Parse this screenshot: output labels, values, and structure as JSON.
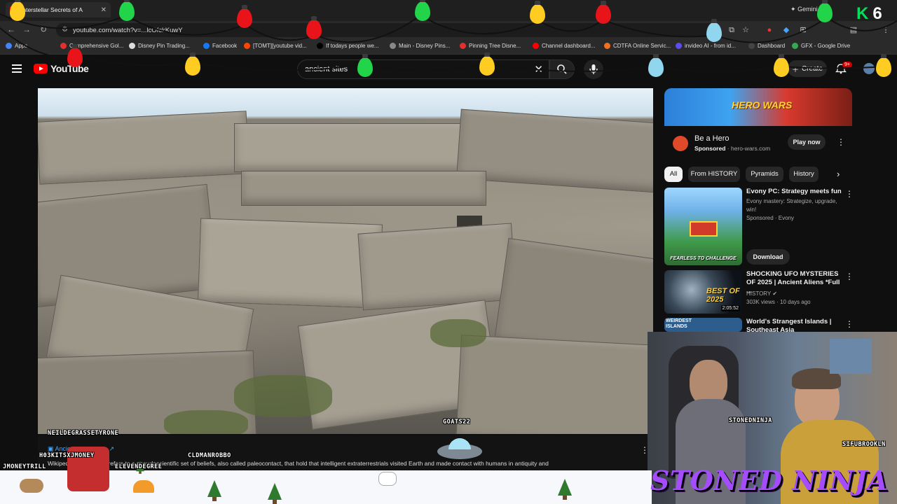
{
  "browser": {
    "tab_title": "Interstellar Secrets of A",
    "url": "youtube.com/watch?v=...lcOfckKuwY",
    "bookmarks": [
      {
        "label": "Apps",
        "color": "#4285f4"
      },
      {
        "label": "Comprehensive Gol...",
        "color": "#e03030"
      },
      {
        "label": "Disney Pin Trading...",
        "color": "#dddddd"
      },
      {
        "label": "Facebook",
        "color": "#1877f2"
      },
      {
        "label": "[TOMT][youtube vid...",
        "color": "#ff4500"
      },
      {
        "label": "If todays people we...",
        "color": "#000000"
      },
      {
        "label": "Main - Disney Pins...",
        "color": "#888888"
      },
      {
        "label": "Pinning Tree Disne...",
        "color": "#e03030"
      },
      {
        "label": "Channel dashboard...",
        "color": "#ff0000"
      },
      {
        "label": "CDTFA Online Servic...",
        "color": "#f07020"
      },
      {
        "label": "invideo AI - from id...",
        "color": "#5b4df0"
      },
      {
        "label": "Dashboard",
        "color": "#444444"
      },
      {
        "label": "GFX - Google Drive",
        "color": "#34a853"
      }
    ],
    "gemini_label": "Gemini"
  },
  "youtube": {
    "logo_text": "YouTube",
    "search_query": "ancient sites",
    "create_label": "Create",
    "notif_badge": "9+"
  },
  "ad": {
    "banner_text": "HERO WARS",
    "title": "Be a Hero",
    "sponsored": "Sponsored",
    "domain": "hero-wars.com",
    "cta": "Play now"
  },
  "chips": [
    "All",
    "From HISTORY",
    "Pyramids",
    "History"
  ],
  "recs": [
    {
      "title": "Evony PC: Strategy meets fun",
      "line1": "Evony mastery: Strategize, upgrade,",
      "line2": "win!",
      "line3": "Sponsored · Evony",
      "thumb_text": "FEARLESS TO CHALLENGE",
      "cta": "Download"
    },
    {
      "title": "SHOCKING UFO MYSTERIES OF 2025 | Ancient Aliens *Full ...",
      "line1": "HISTORY",
      "line2": "303K views · 10 days ago",
      "thumb_text": "BEST OF 2025",
      "duration": "2:05:52"
    },
    {
      "title": "World's Strangest Islands | Southeast Asia",
      "thumb_text": "WEIRDEST ISLANDS"
    }
  ],
  "overlay": {
    "info_label": "Ancient astronauts ↗",
    "info_text": "Wikipedia · astronauts refers to a pseudoscientific set of beliefs, also called paleocontact, that hold that intelligent extraterrestrials visited Earth and made contact with humans in antiquity and",
    "names": [
      "NEILDEGRASSETYRONE",
      "GOATS22",
      "H03KITSXJMONEY",
      "CLDMANROBBO",
      "JMONEYTRILL",
      "ELEVENDEGREE",
      "STONEDNINJA",
      "SIFUBROOKLN"
    ],
    "brand": "STONED NINJA",
    "corner_logo": "K",
    "corner_num": "6"
  },
  "colors": {
    "bg": "#0f0f0f",
    "accent_red": "#ff0000",
    "brand_purple": "#a64cff"
  }
}
